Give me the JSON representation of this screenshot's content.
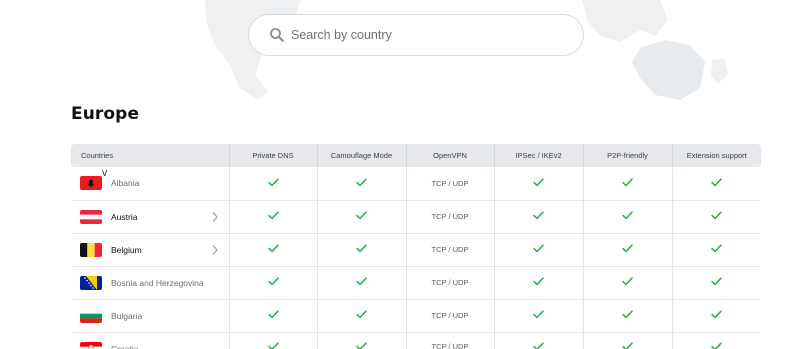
{
  "search": {
    "placeholder": "Search by country"
  },
  "region": {
    "title": "Europe"
  },
  "table": {
    "headers": [
      "Countries",
      "Private DNS",
      "Camouflage Mode",
      "OpenVPN",
      "IPSec / IKEv2",
      "P2P-friendly",
      "Extension support"
    ],
    "rows": [
      {
        "country": "Albania",
        "flag": "albania",
        "muted": true,
        "chevron": false,
        "openvpn": "TCP / UDP"
      },
      {
        "country": "Austria",
        "flag": "austria",
        "muted": false,
        "chevron": true,
        "openvpn": "TCP / UDP"
      },
      {
        "country": "Belgium",
        "flag": "belgium",
        "muted": false,
        "chevron": true,
        "openvpn": "TCP / UDP"
      },
      {
        "country": "Bosnia and Herzegovina",
        "flag": "bosnia",
        "muted": true,
        "chevron": false,
        "openvpn": "TCP / UDP"
      },
      {
        "country": "Bulgaria",
        "flag": "bulgaria",
        "muted": true,
        "chevron": false,
        "openvpn": "TCP / UDP"
      },
      {
        "country": "Croatia",
        "flag": "croatia",
        "muted": true,
        "chevron": false,
        "openvpn": "TCP / UDP"
      }
    ],
    "cursor_mark": "V"
  },
  "colors": {
    "check": "#22b14c",
    "header_bg": "#e6e8eb",
    "text": "#111111"
  },
  "icons": {
    "search": "search-icon",
    "check": "check-icon",
    "chevron": "chevron-right-icon"
  }
}
